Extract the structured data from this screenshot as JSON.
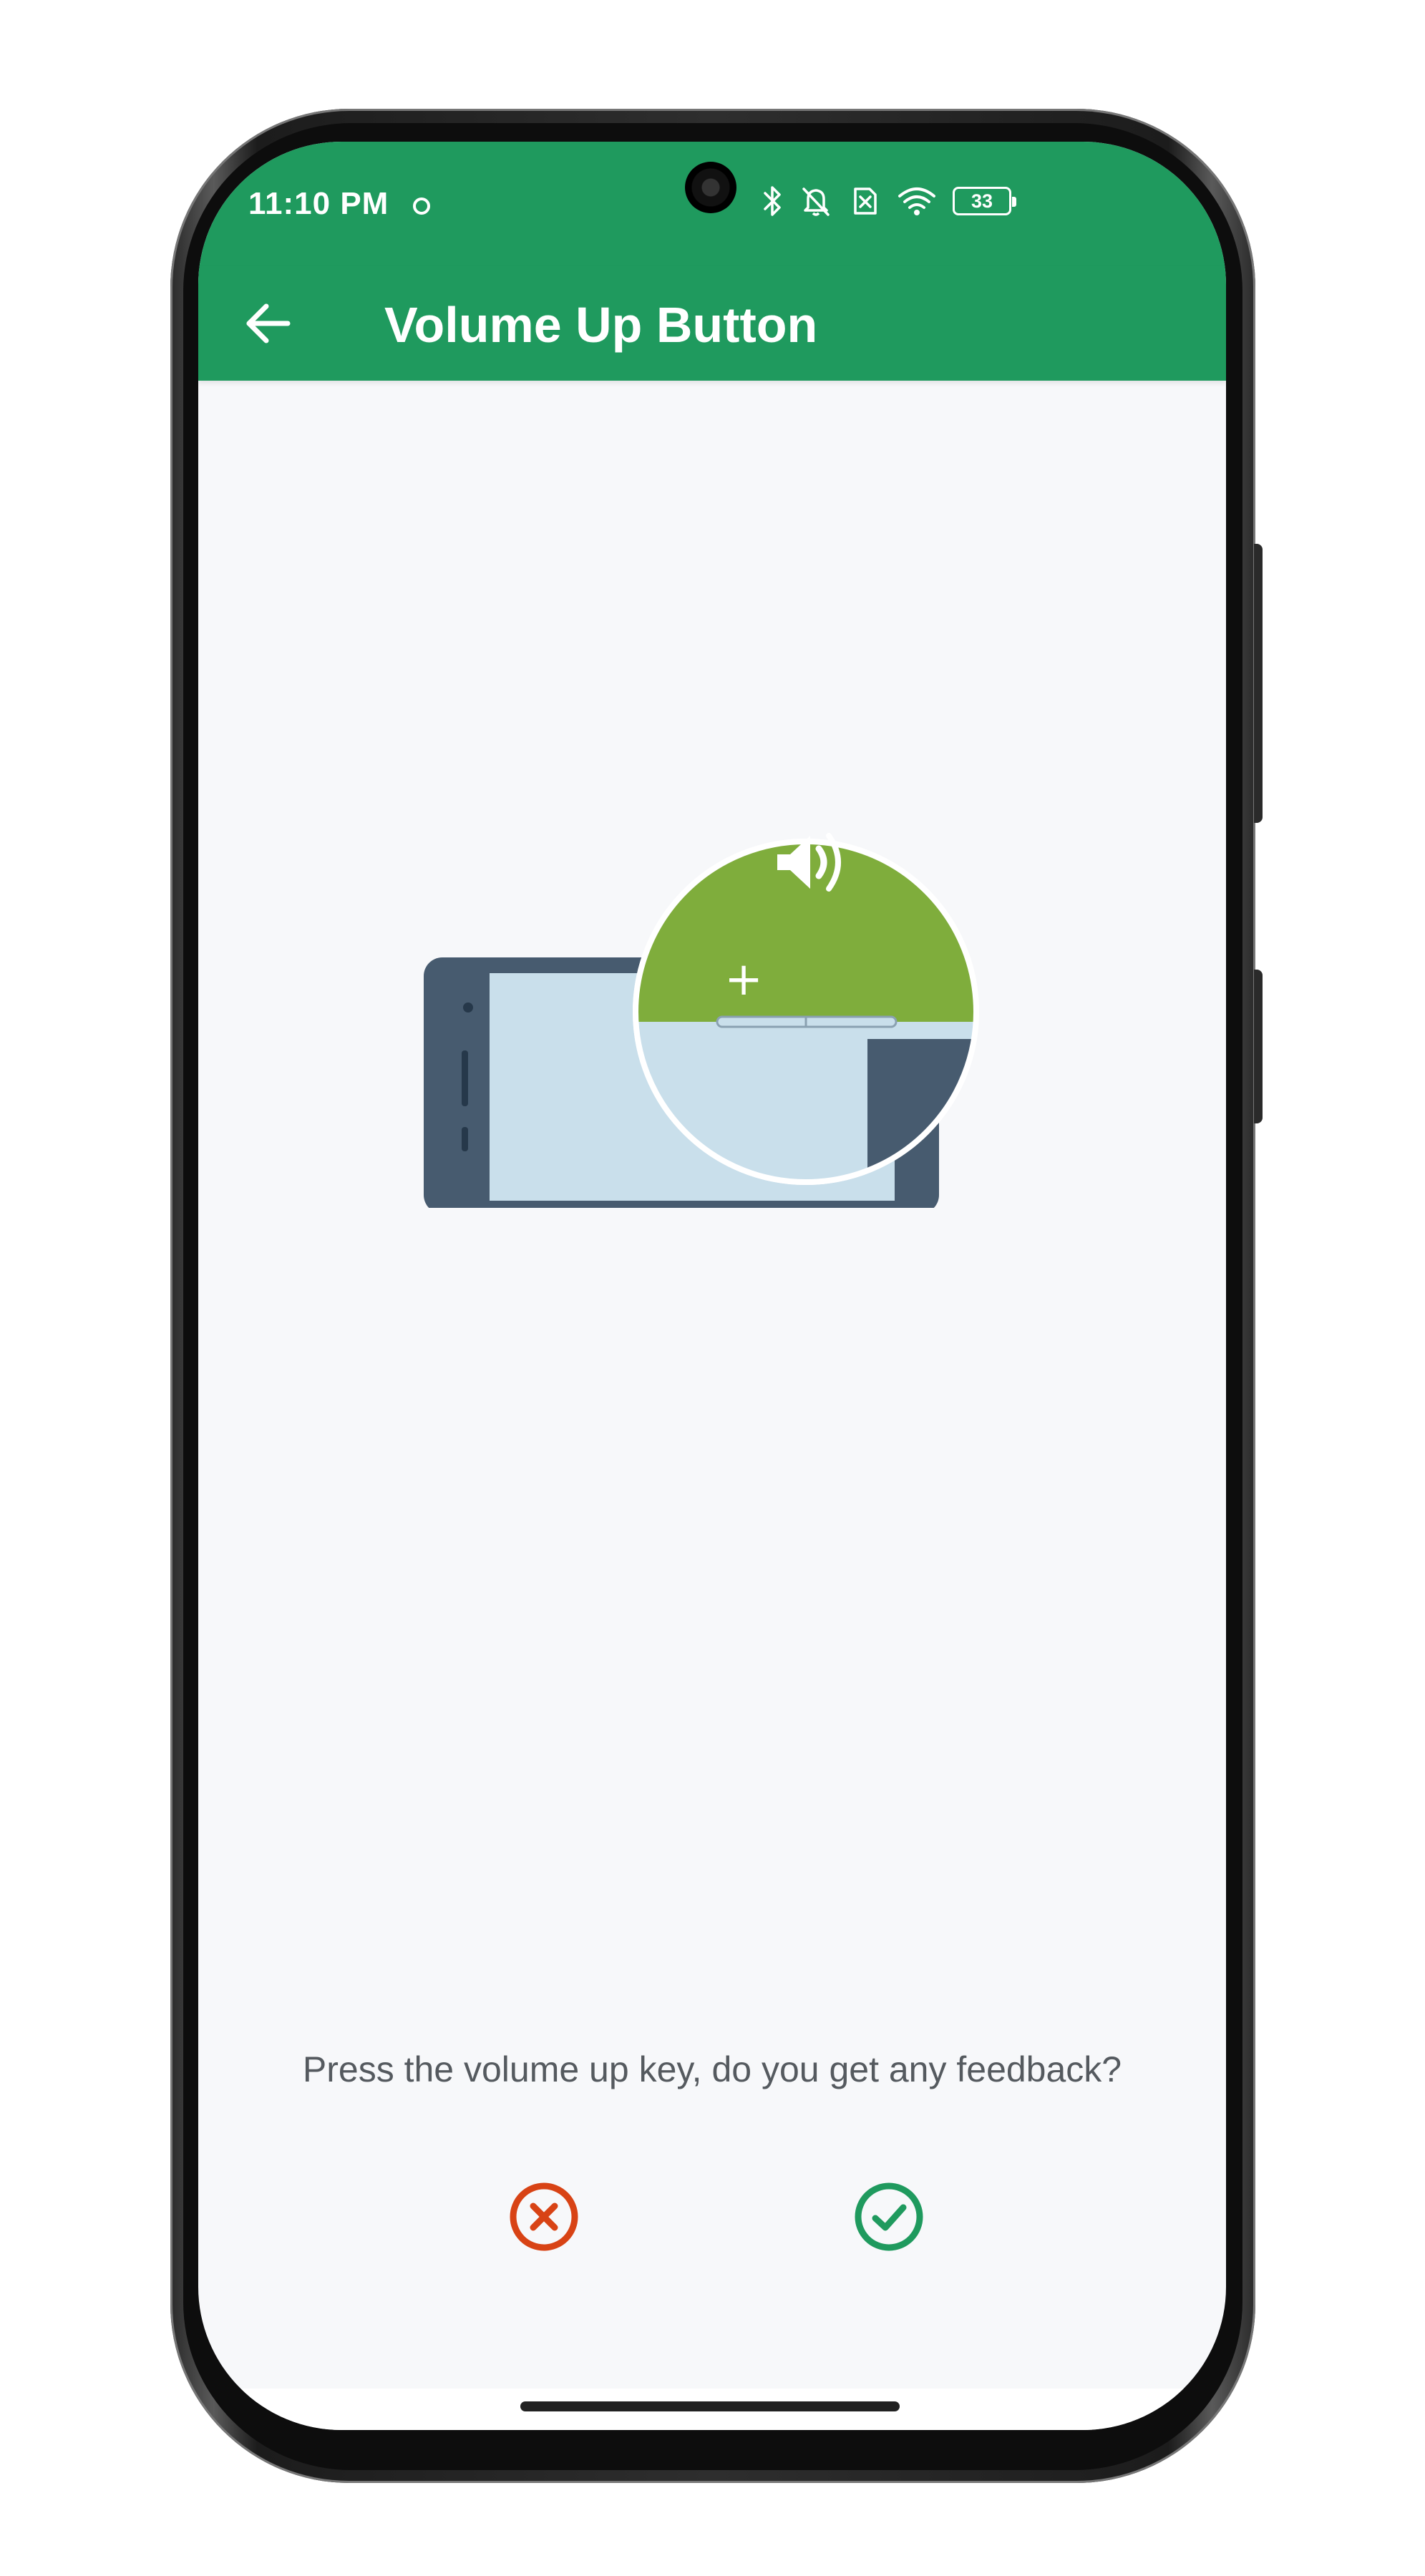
{
  "status_bar": {
    "time": "11:10 PM",
    "battery_level": "33",
    "icons": [
      "bluetooth-icon",
      "notifications-off-icon",
      "no-sim-icon",
      "wifi-icon",
      "battery-icon"
    ]
  },
  "toolbar": {
    "title": "Volume Up Button",
    "back_icon": "arrow-back-icon"
  },
  "illustration": {
    "magnifier_symbol": "+",
    "icons": [
      "speaker-icon"
    ]
  },
  "prompt": {
    "question": "Press the volume up key, do you get any feedback?"
  },
  "answers": {
    "no_icon": "close-circle-icon",
    "yes_icon": "check-circle-icon"
  },
  "colors": {
    "app_bar": "#1f9a5e",
    "background": "#f7f8fa",
    "magnifier_green": "#7fad3c",
    "phone_slate": "#475b6f",
    "screen_blue": "#c9dfeb",
    "no_red": "#d84315",
    "yes_green": "#1f9a5e",
    "question_text": "#555a5f"
  }
}
